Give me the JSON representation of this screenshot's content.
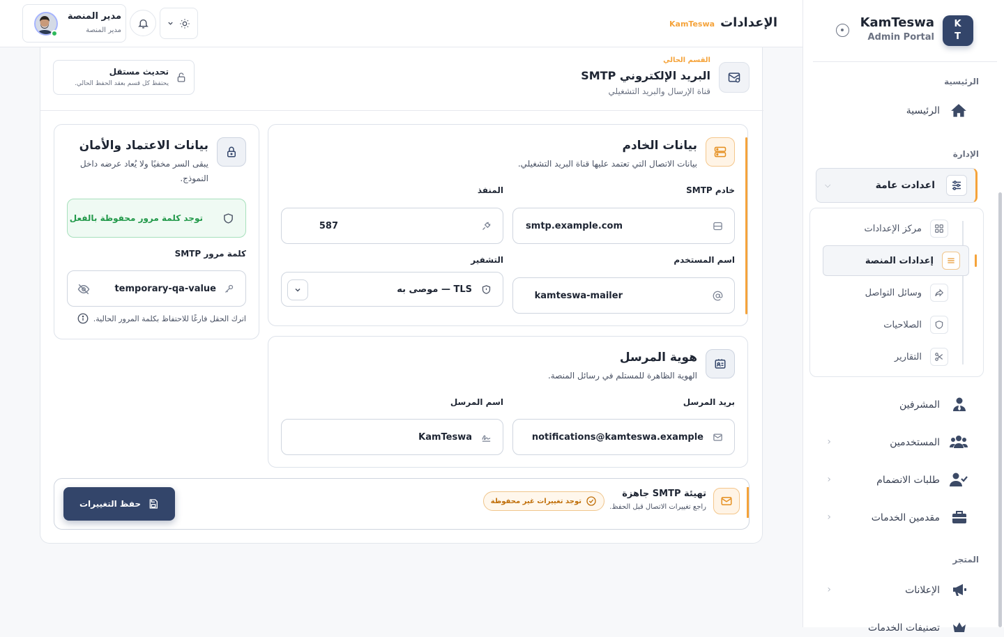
{
  "brand": {
    "initials_top": "K",
    "initials_bottom": "T",
    "name": "KamTeswa",
    "subtitle": "Admin Portal"
  },
  "sidebar": {
    "sections": {
      "home": "الرئيسية",
      "admin": "الإدارة",
      "store": "المتجر"
    },
    "home_item": "الرئيسية",
    "active_group": "اعدادت عامة",
    "sub_items": [
      "مركز الإعدادات",
      "إعدادات المنصة",
      "وسائل التواصل",
      "الصلاحيات",
      "التقارير"
    ],
    "admin_items": [
      "المشرفين",
      "المستخدمين",
      "طلبات الانضمام",
      "مقدمين الخدمات"
    ],
    "store_items": [
      "الإعلانات",
      "تصنيفات الخدمات"
    ]
  },
  "header": {
    "title": "الإعدادات",
    "brand_tag": "KamTeswa"
  },
  "user": {
    "name": "مدير المنصة",
    "role": "مدير المنصة"
  },
  "section": {
    "current_label": "القسم الحالي",
    "title": "البريد الإلكتروني SMTP",
    "subtitle": "قناة الإرسال والبريد التشغيلي",
    "independent_title": "تحديث مستقل",
    "independent_sub": "يحتفظ كل قسم بعقد الحفظ الحالي."
  },
  "server": {
    "title": "بيانات الخادم",
    "subtitle": "بيانات الاتصال التي تعتمد عليها قناة البريد التشغيلي.",
    "host_label": "خادم SMTP",
    "host_value": "smtp.example.com",
    "port_label": "المنفذ",
    "port_value": "587",
    "user_label": "اسم المستخدم",
    "user_value": "kamteswa-mailer",
    "enc_label": "التشفير",
    "enc_value": "TLS — موصى به"
  },
  "credentials": {
    "title": "بيانات الاعتماد والأمان",
    "subtitle": "يبقى السر مخفيًا ولا يُعاد عرضه داخل النموذج.",
    "saved_notice": "توجد كلمة مرور محفوظة بالفعل",
    "password_label": "كلمة مرور SMTP",
    "password_value": "temporary-qa-value",
    "hint": "اترك الحقل فارغًا للاحتفاظ بكلمة المرور الحالية."
  },
  "sender": {
    "title": "هوية المرسل",
    "subtitle": "الهوية الظاهرة للمستلم في رسائل المنصة.",
    "email_label": "بريد المرسل",
    "email_value": "notifications@kamteswa.example",
    "name_label": "اسم المرسل",
    "name_value": "KamTeswa"
  },
  "savebar": {
    "title": "تهيئة SMTP جاهزة",
    "subtitle": "راجع تغييرات الاتصال قبل الحفظ.",
    "badge": "توجد تغييرات غير محفوظة",
    "save_label": "حفظ التغييرات"
  },
  "colors": {
    "accent": "#f5a33a",
    "primary": "#33456a",
    "success": "#2fb95c"
  }
}
